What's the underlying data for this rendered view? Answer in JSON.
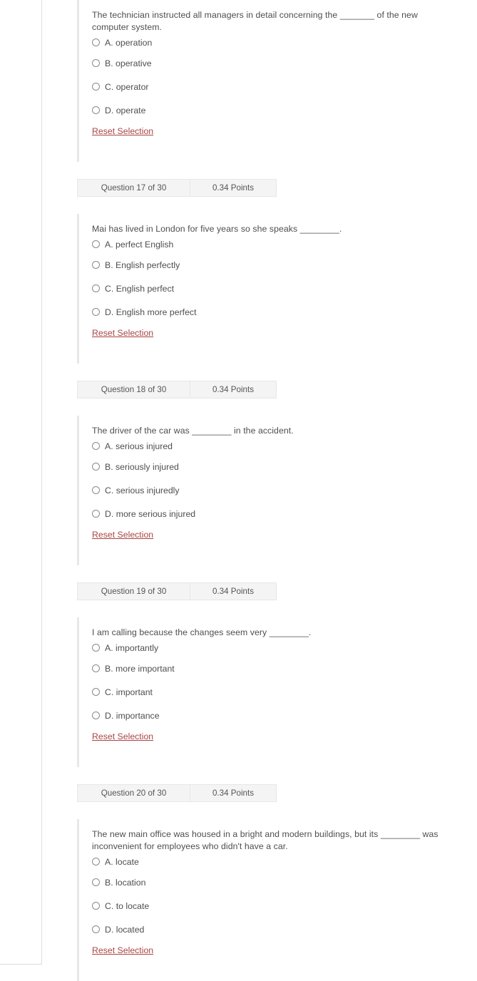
{
  "page": {
    "total_questions": 30
  },
  "reset_label": "Reset Selection",
  "points_label": "0.34 Points",
  "questions": [
    {
      "header": null,
      "stem": "The technician instructed all managers in detail concerning the _______ of the new computer system.",
      "options": [
        "A. operation",
        "B. operative",
        "C. operator",
        "D. operate"
      ],
      "reset": "Reset Selection"
    },
    {
      "header": {
        "number": "Question 17 of 30",
        "points": "0.34 Points"
      },
      "stem": "Mai has lived in London for five years so she speaks ________.",
      "options": [
        "A. perfect English",
        "B. English perfectly",
        "C. English perfect",
        "D. English more perfect"
      ],
      "reset": "Reset Selection"
    },
    {
      "header": {
        "number": "Question 18 of 30",
        "points": "0.34 Points"
      },
      "stem": "The driver of the car was ________ in the accident.",
      "options": [
        "A. serious injured",
        "B. seriously injured",
        "C. serious injuredly",
        "D. more serious injured"
      ],
      "reset": "Reset Selection"
    },
    {
      "header": {
        "number": "Question 19 of 30",
        "points": "0.34 Points"
      },
      "stem": "I am calling because the changes seem very ________.",
      "options": [
        "A. importantly",
        "B. more important",
        "C. important",
        "D. importance"
      ],
      "reset": "Reset Selection"
    },
    {
      "header": {
        "number": "Question 20 of 30",
        "points": "0.34 Points"
      },
      "stem": "The new main office was housed in a bright and modern buildings, but its ________ was inconvenient for employees who didn't have a car.",
      "options": [
        "A. locate",
        "B. location",
        "C. to locate",
        "D. located"
      ],
      "reset": "Reset Selection"
    }
  ],
  "colors": {
    "link": "#a94442",
    "text": "#4e4e4e",
    "bar_bg": "#f4f4f4",
    "bar_border": "#e7e7e7",
    "block_border": "#e8e8e8"
  }
}
